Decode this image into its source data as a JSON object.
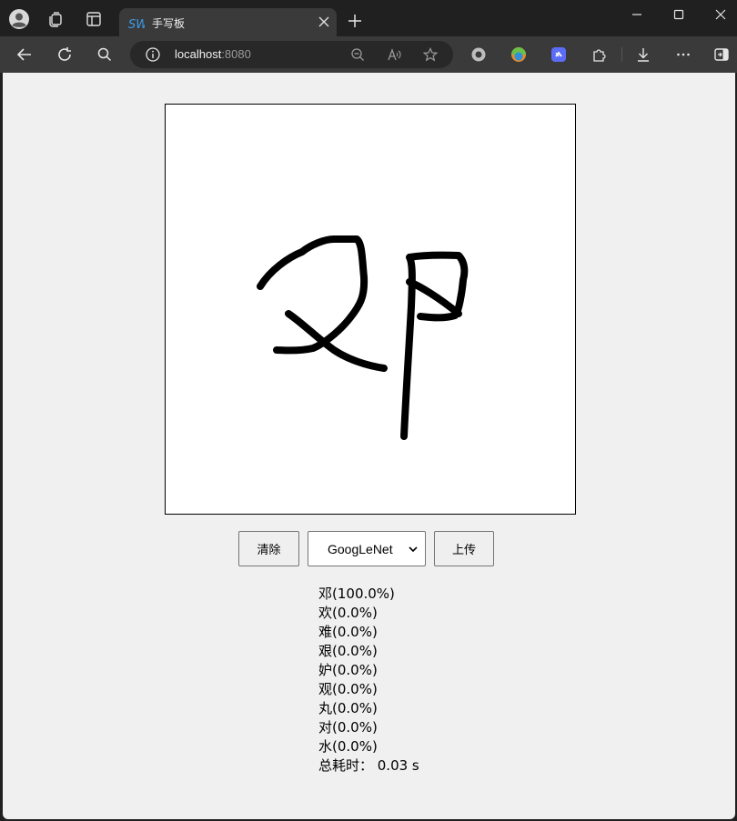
{
  "browser": {
    "tab_title": "手写板",
    "url_host": "localhost",
    "url_port": ":8080"
  },
  "page": {
    "buttons": {
      "clear": "清除",
      "upload": "上传"
    },
    "model_select": {
      "selected": "GoogLeNet"
    },
    "predictions": [
      {
        "label": "邓(100.0%)"
      },
      {
        "label": "欢(0.0%)"
      },
      {
        "label": "难(0.0%)"
      },
      {
        "label": "艰(0.0%)"
      },
      {
        "label": "妒(0.0%)"
      },
      {
        "label": "观(0.0%)"
      },
      {
        "label": "丸(0.0%)"
      },
      {
        "label": "对(0.0%)"
      },
      {
        "label": "水(0.0%)"
      }
    ],
    "total_time": "总耗时： 0.03 s"
  },
  "icons": {
    "profile": "profile-icon",
    "workspaces": "workspaces-icon",
    "tab_actions": "tab-actions-icon",
    "back": "back-icon",
    "refresh": "refresh-icon",
    "search": "search-icon",
    "info": "info-icon",
    "zoom": "zoom-out-icon",
    "read_aloud": "read-aloud-icon",
    "favorite": "favorite-star-icon",
    "downloads": "download-icon",
    "more": "more-icon",
    "sidebar": "sidebar-icon"
  },
  "colors": {
    "page_bg": "#f0f0f0",
    "chrome_dark": "#202020",
    "chrome_toolbar": "#3a3a3a",
    "ink": "#000000"
  }
}
